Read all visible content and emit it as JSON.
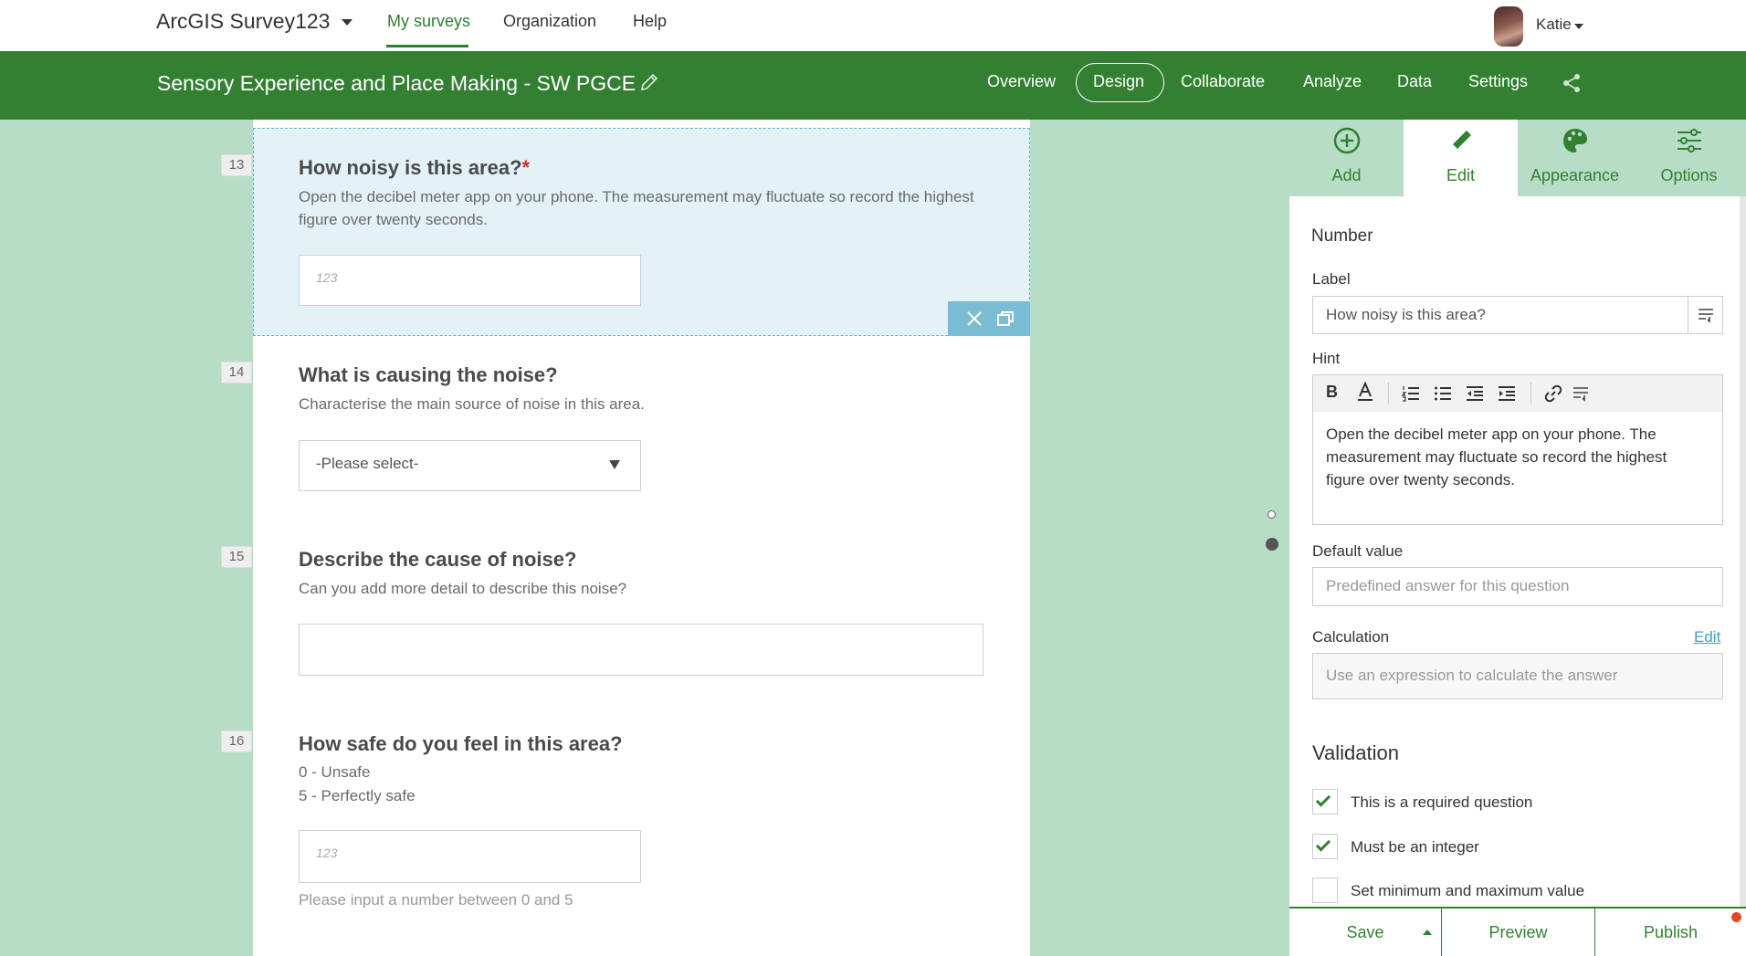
{
  "app": {
    "brand": "ArcGIS Survey123",
    "nav": [
      "My surveys",
      "Organization",
      "Help"
    ],
    "user": "Katie"
  },
  "survey": {
    "title": "Sensory Experience and Place Making - SW PGCE",
    "tabs": [
      "Overview",
      "Design",
      "Collaborate",
      "Analyze",
      "Data",
      "Settings"
    ]
  },
  "questions": [
    {
      "number": "13",
      "title": "How noisy is this area?",
      "required_mark": "*",
      "hint": "Open the decibel meter app on your phone. The measurement may fluctuate so record the highest figure over twenty seconds.",
      "type": "number"
    },
    {
      "number": "14",
      "title": "What is causing the noise?",
      "hint": "Characterise the main source of noise in this area.",
      "select_placeholder": "-Please select-"
    },
    {
      "number": "15",
      "title": "Describe the cause of noise?",
      "hint": "Can you add more detail to describe this noise?"
    },
    {
      "number": "16",
      "title": "How safe do you feel in this area?",
      "hint_lines": [
        "0 - Unsafe",
        "5 - Perfectly safe"
      ],
      "note": "Please input a number between 0 and 5"
    }
  ],
  "number_placeholder": "123",
  "panel": {
    "tabs": [
      "Add",
      "Edit",
      "Appearance",
      "Options"
    ],
    "type_label": "Number",
    "label_title": "Label",
    "label_value": "How noisy is this area?",
    "hint_title": "Hint",
    "hint_value": "Open the decibel meter app on your phone. The measurement may fluctuate so record the highest figure over twenty seconds.",
    "default_title": "Default value",
    "default_placeholder": "Predefined answer for this question",
    "calc_title": "Calculation",
    "calc_edit": "Edit",
    "calc_placeholder": "Use an expression to calculate the answer",
    "validation_title": "Validation",
    "checks": [
      {
        "label": "This is a required question",
        "checked": true
      },
      {
        "label": "Must be an integer",
        "checked": true
      },
      {
        "label": "Set minimum and maximum value",
        "checked": false
      }
    ],
    "actions": [
      "Save",
      "Preview",
      "Publish"
    ]
  },
  "colors": {
    "brand_green": "#338033",
    "canvas_bg": "#b7ddc6",
    "selected_bg": "#e3f2f6",
    "required_red": "#d32f2f"
  }
}
